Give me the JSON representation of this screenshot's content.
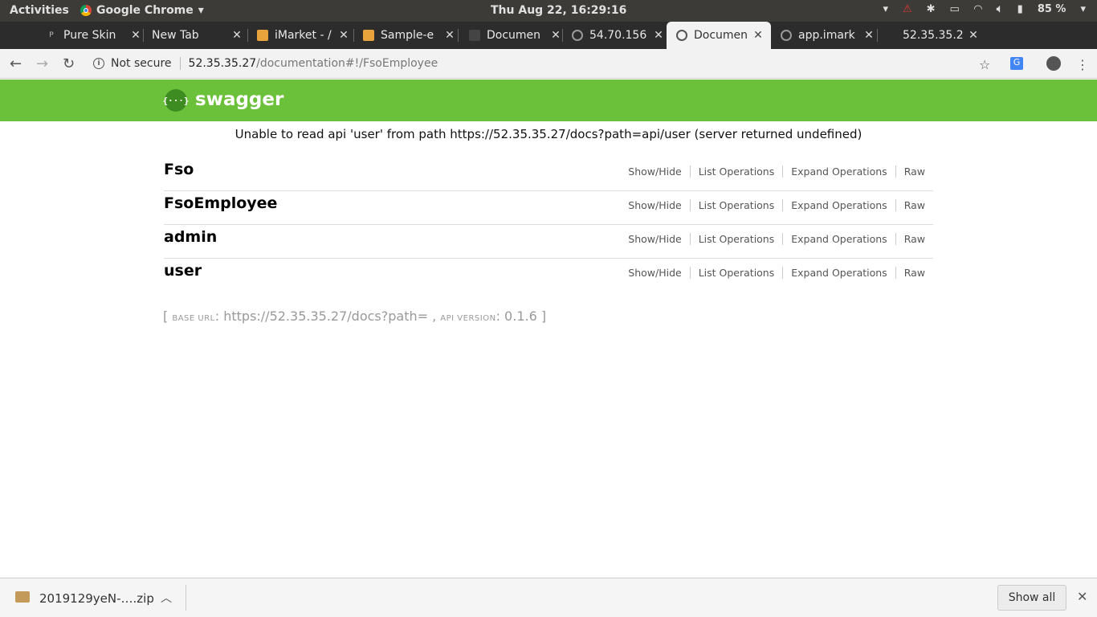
{
  "system": {
    "activities": "Activities",
    "app_name": "Google Chrome",
    "clock": "Thu Aug 22, 16:29:16",
    "battery": "85 %"
  },
  "tabs": [
    {
      "title": "Pure Skin",
      "active": false
    },
    {
      "title": "New Tab",
      "active": false
    },
    {
      "title": "iMarket - /",
      "active": false
    },
    {
      "title": "Sample-e",
      "active": false
    },
    {
      "title": "Documen",
      "active": false
    },
    {
      "title": "54.70.156",
      "active": false
    },
    {
      "title": "Documen",
      "active": true
    },
    {
      "title": "app.imark",
      "active": false
    },
    {
      "title": "52.35.35.2",
      "active": false
    }
  ],
  "address": {
    "security": "Not secure",
    "host": "52.35.35.27",
    "path": "/documentation#!/FsoEmployee"
  },
  "swagger": {
    "title": "swagger",
    "logo_glyph": "{···}",
    "error": "Unable to read api 'user' from path https://52.35.35.27/docs?path=api/user (server returned undefined)",
    "resources": [
      {
        "name": "Fso"
      },
      {
        "name": "FsoEmployee"
      },
      {
        "name": "admin"
      },
      {
        "name": "user"
      }
    ],
    "ops": {
      "show_hide": "Show/Hide",
      "list": "List Operations",
      "expand": "Expand Operations",
      "raw": "Raw"
    },
    "footer": {
      "open": "[",
      "base_label": "base url",
      "base_value": "https://52.35.35.27/docs?path=",
      "comma": ",",
      "api_label": "api version",
      "api_value": "0.1.6",
      "close": "]"
    }
  },
  "download": {
    "filename": "2019129yeN-….zip",
    "show_all": "Show all"
  },
  "colors": {
    "swagger_green": "#6cc13b"
  }
}
